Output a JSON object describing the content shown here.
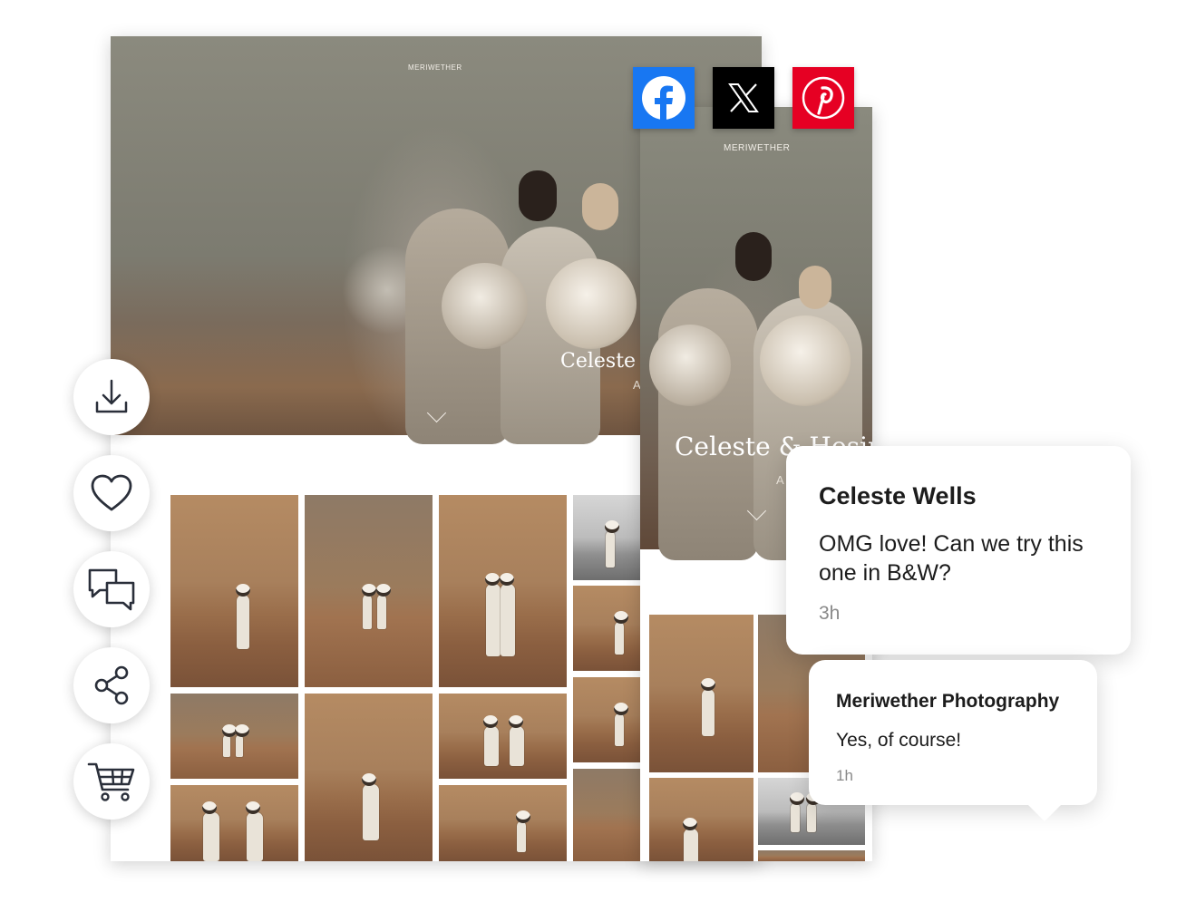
{
  "desktop_gallery": {
    "brand": "MERIWETHER",
    "title": "Celeste &",
    "subtitle": "A"
  },
  "mobile_gallery": {
    "brand": "MERIWETHER",
    "title": "Celeste & Hosin",
    "subtitle": "A"
  },
  "social_share": [
    {
      "name": "Facebook",
      "icon": "facebook-icon",
      "color": "#1877F2"
    },
    {
      "name": "X",
      "icon": "x-icon",
      "color": "#000000"
    },
    {
      "name": "Pinterest",
      "icon": "pinterest-icon",
      "color": "#E60023"
    }
  ],
  "actions": [
    {
      "icon": "download-icon"
    },
    {
      "icon": "heart-icon"
    },
    {
      "icon": "comments-icon"
    },
    {
      "icon": "share-icon"
    },
    {
      "icon": "cart-icon"
    }
  ],
  "comments": [
    {
      "author": "Celeste Wells",
      "text": "OMG love! Can we try this one in B&W?",
      "time": "3h"
    },
    {
      "author": "Meriwether Photography",
      "text": "Yes, of course!",
      "time": "1h"
    }
  ]
}
